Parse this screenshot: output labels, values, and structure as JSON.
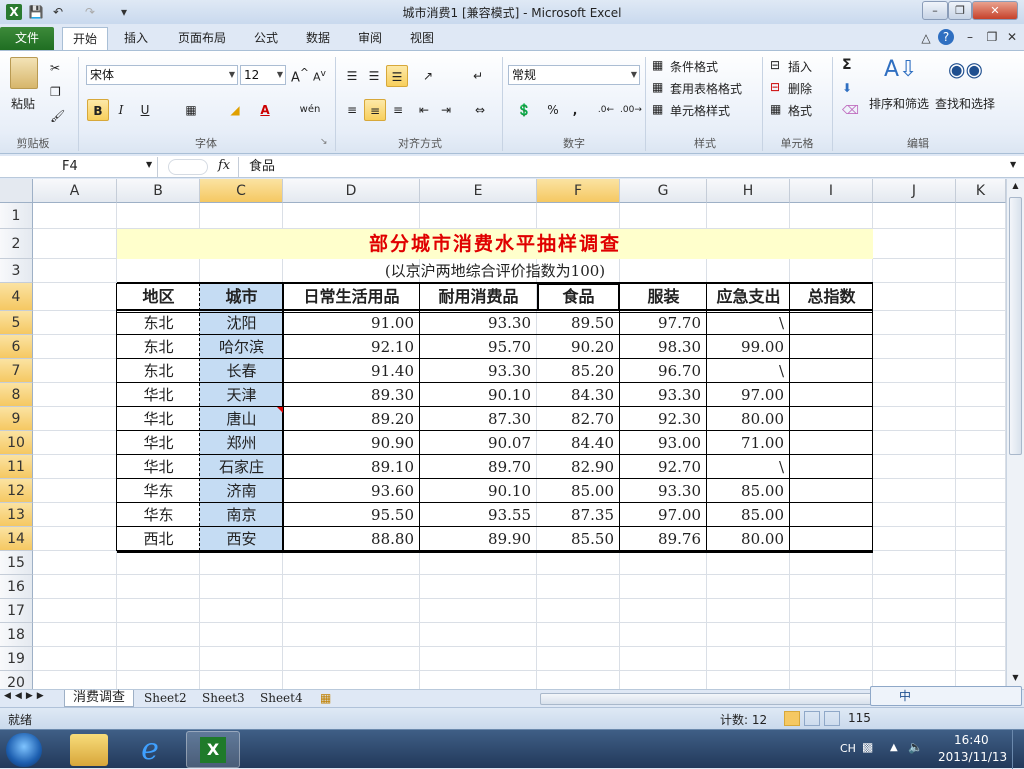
{
  "window": {
    "title": "城市消费1  [兼容模式]  -  Microsoft Excel"
  },
  "tabs": [
    "文件",
    "开始",
    "插入",
    "页面布局",
    "公式",
    "数据",
    "审阅",
    "视图"
  ],
  "ribbon": {
    "clipboard": {
      "paste": "粘贴",
      "label": "剪贴板"
    },
    "font": {
      "name": "宋体",
      "size": "12",
      "label": "字体",
      "bold": "B",
      "italic": "I",
      "underline": "U",
      "wen": "wén"
    },
    "alignment": {
      "label": "对齐方式"
    },
    "number": {
      "format": "常规",
      "label": "数字",
      "percent": "%",
      "comma": ","
    },
    "styles": {
      "cond": "条件格式",
      "table": "套用表格格式",
      "cell": "单元格样式",
      "label": "样式"
    },
    "cells": {
      "insert": "插入",
      "delete": "删除",
      "format": "格式",
      "label": "单元格"
    },
    "editing": {
      "sort": "排序和筛选",
      "find": "查找和选择",
      "label": "编辑",
      "sigma": "Σ"
    }
  },
  "formula_bar": {
    "name_box": "F4",
    "fx": "fx",
    "content": "食品"
  },
  "columns": [
    "A",
    "B",
    "C",
    "D",
    "E",
    "F",
    "G",
    "H",
    "I",
    "J",
    "K"
  ],
  "rows": [
    "1",
    "2",
    "3",
    "4",
    "5",
    "6",
    "7",
    "8",
    "9",
    "10",
    "11",
    "12",
    "13",
    "14",
    "15",
    "16",
    "17",
    "18",
    "19",
    "20"
  ],
  "sheet": {
    "title": "部分城市消费水平抽样调查",
    "subtitle": "(以京沪两地综合评价指数为100)",
    "headers": [
      "地区",
      "城市",
      "日常生活用品",
      "耐用消费品",
      "食品",
      "服装",
      "应急支出",
      "总指数"
    ],
    "data": [
      [
        "东北",
        "沈阳",
        "91.00",
        "93.30",
        "89.50",
        "97.70",
        "\\",
        ""
      ],
      [
        "东北",
        "哈尔滨",
        "92.10",
        "95.70",
        "90.20",
        "98.30",
        "99.00",
        ""
      ],
      [
        "东北",
        "长春",
        "91.40",
        "93.30",
        "85.20",
        "96.70",
        "\\",
        ""
      ],
      [
        "华北",
        "天津",
        "89.30",
        "90.10",
        "84.30",
        "93.30",
        "97.00",
        ""
      ],
      [
        "华北",
        "唐山",
        "89.20",
        "87.30",
        "82.70",
        "92.30",
        "80.00",
        ""
      ],
      [
        "华北",
        "郑州",
        "90.90",
        "90.07",
        "84.40",
        "93.00",
        "71.00",
        ""
      ],
      [
        "华北",
        "石家庄",
        "89.10",
        "89.70",
        "82.90",
        "92.70",
        "\\",
        ""
      ],
      [
        "华东",
        "济南",
        "93.60",
        "90.10",
        "85.00",
        "93.30",
        "85.00",
        ""
      ],
      [
        "华东",
        "南京",
        "95.50",
        "93.55",
        "87.35",
        "97.00",
        "85.00",
        ""
      ],
      [
        "西北",
        "西安",
        "88.80",
        "89.90",
        "85.50",
        "89.76",
        "80.00",
        ""
      ]
    ]
  },
  "sheet_tabs": [
    "消费调查",
    "Sheet2",
    "Sheet3",
    "Sheet4"
  ],
  "status": {
    "ready": "就绪",
    "count": "计数: 12",
    "zoom": "115"
  },
  "ime": {
    "zh": "中"
  },
  "taskbar": {
    "lang": "CH",
    "time": "16:40",
    "date": "2013/11/13"
  },
  "colors": {
    "title_red": "#e00000",
    "title_fill": "#ffffcc",
    "col_c_fill": "#c5dcf3",
    "select_orange": "#f5c862"
  }
}
